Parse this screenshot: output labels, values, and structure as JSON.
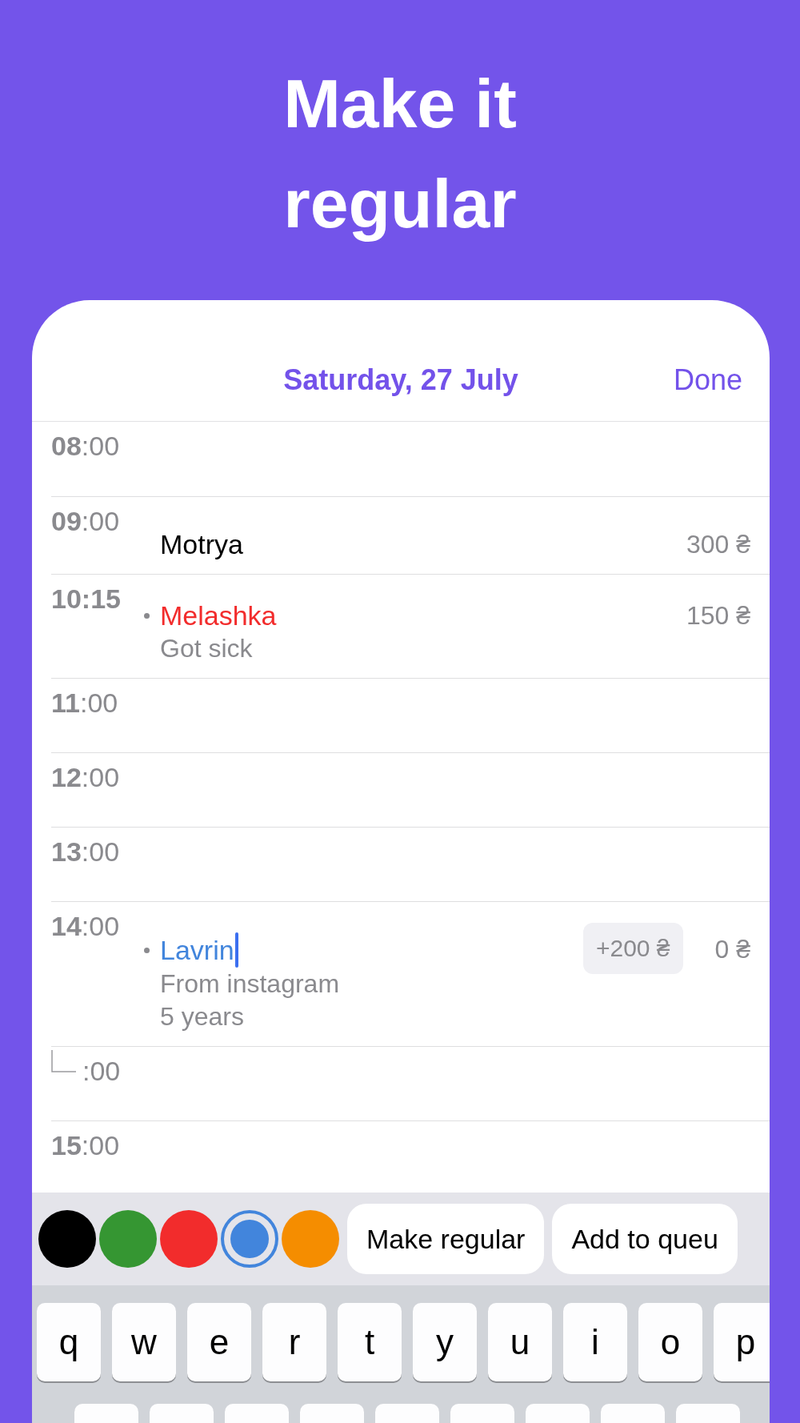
{
  "headline": "Make it regular",
  "nav": {
    "title": "Saturday, 27 July",
    "done": "Done"
  },
  "slots": [
    {
      "kind": "hour",
      "hour": "08",
      "minutes": ":00"
    },
    {
      "kind": "hour",
      "hour": "09",
      "minutes": ":00",
      "appointment": {
        "name": "Motrya",
        "color": "#000000",
        "bulleted": false,
        "editing": false,
        "amount": "300 ₴"
      }
    },
    {
      "kind": "exact",
      "hour": "10:15",
      "appointment": {
        "name": "Melashka",
        "color": "#f22c2c",
        "bulleted": true,
        "editing": false,
        "notes": [
          "Got sick"
        ],
        "amount": "150 ₴"
      }
    },
    {
      "kind": "hour",
      "hour": "11",
      "minutes": ":00"
    },
    {
      "kind": "hour",
      "hour": "12",
      "minutes": ":00"
    },
    {
      "kind": "hour",
      "hour": "13",
      "minutes": ":00"
    },
    {
      "kind": "hour",
      "hour": "14",
      "minutes": ":00",
      "appointment": {
        "name": "Lavrin",
        "color": "#4285dc",
        "bulleted": true,
        "editing": true,
        "notes": [
          "From instagram",
          "5 years"
        ],
        "tip": "+200 ₴",
        "amount": "0 ₴"
      }
    },
    {
      "kind": "sub",
      "minutes": ":00"
    },
    {
      "kind": "hour",
      "hour": "15",
      "minutes": ":00"
    }
  ],
  "toolbar": {
    "colors": [
      {
        "color": "#000000",
        "selected": false
      },
      {
        "color": "#359632",
        "selected": false
      },
      {
        "color": "#f22c2c",
        "selected": false
      },
      {
        "color": "#4285dc",
        "selected": true
      },
      {
        "color": "#f58d00",
        "selected": false
      }
    ],
    "actions": [
      "Make regular",
      "Add to queu"
    ]
  },
  "keyboard": {
    "rows": [
      [
        "q",
        "w",
        "e",
        "r",
        "t",
        "y",
        "u",
        "i",
        "o",
        "p"
      ]
    ]
  }
}
